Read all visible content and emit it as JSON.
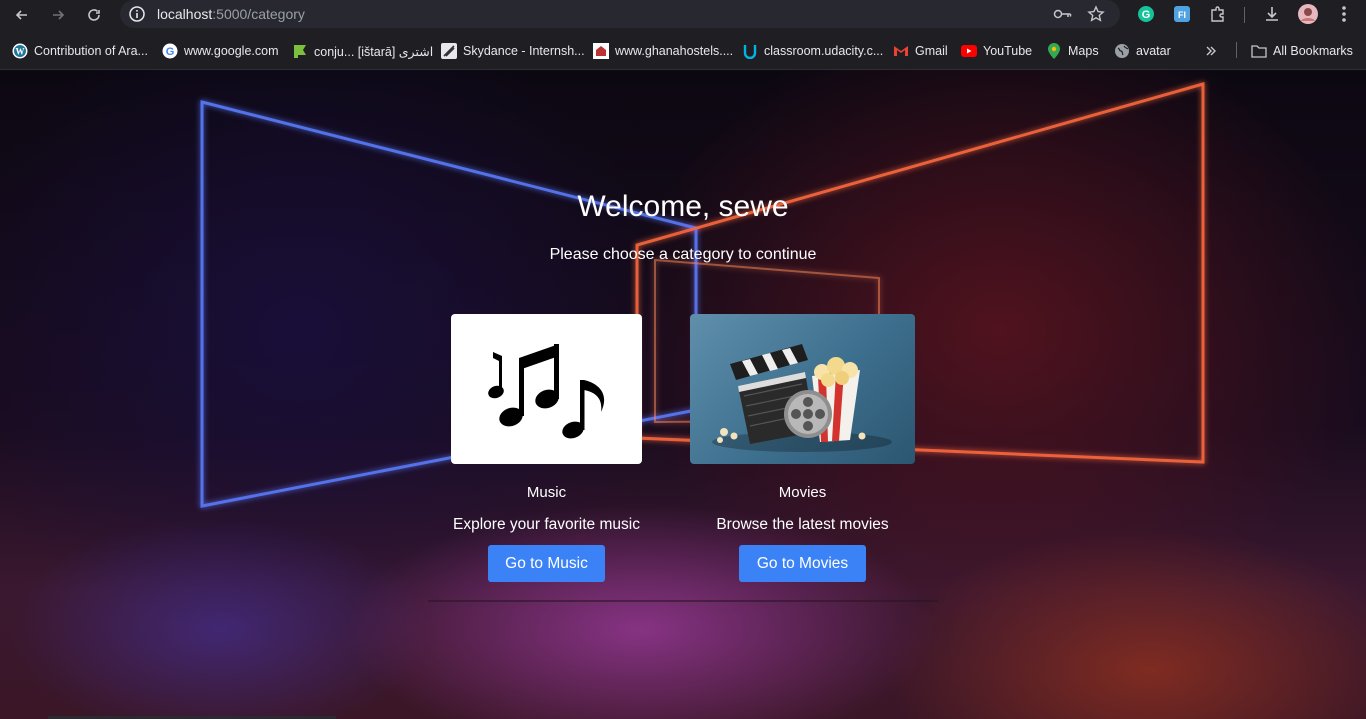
{
  "browser": {
    "url_host": "localhost",
    "url_path": ":5000/category",
    "bookmarks": [
      {
        "label": "Contribution of Ara...",
        "icon": "wordpress-icon"
      },
      {
        "label": "www.google.com",
        "icon": "google-icon"
      },
      {
        "label": "conju... [ištarā] اشترى",
        "icon": "bookmark-green-icon"
      },
      {
        "label": "Skydance - Internsh...",
        "icon": "skydance-icon"
      },
      {
        "label": "www.ghanahostels....",
        "icon": "hostel-icon"
      },
      {
        "label": "classroom.udacity.c...",
        "icon": "udacity-icon"
      },
      {
        "label": "Gmail",
        "icon": "gmail-icon"
      },
      {
        "label": "YouTube",
        "icon": "youtube-icon"
      },
      {
        "label": "Maps",
        "icon": "maps-icon"
      },
      {
        "label": "avatar",
        "icon": "globe-icon"
      }
    ],
    "all_bookmarks_label": "All Bookmarks"
  },
  "page": {
    "welcome": "Welcome, sewe",
    "subtitle": "Please choose a category to continue",
    "cards": [
      {
        "title": "Music",
        "description": "Explore your favorite music",
        "button": "Go to Music",
        "image": "music-notes-image"
      },
      {
        "title": "Movies",
        "description": "Browse the latest movies",
        "button": "Go to Movies",
        "image": "movie-clapper-popcorn-image"
      }
    ]
  },
  "colors": {
    "button": "#3b82f6",
    "chrome_bg": "#1f1f23"
  }
}
